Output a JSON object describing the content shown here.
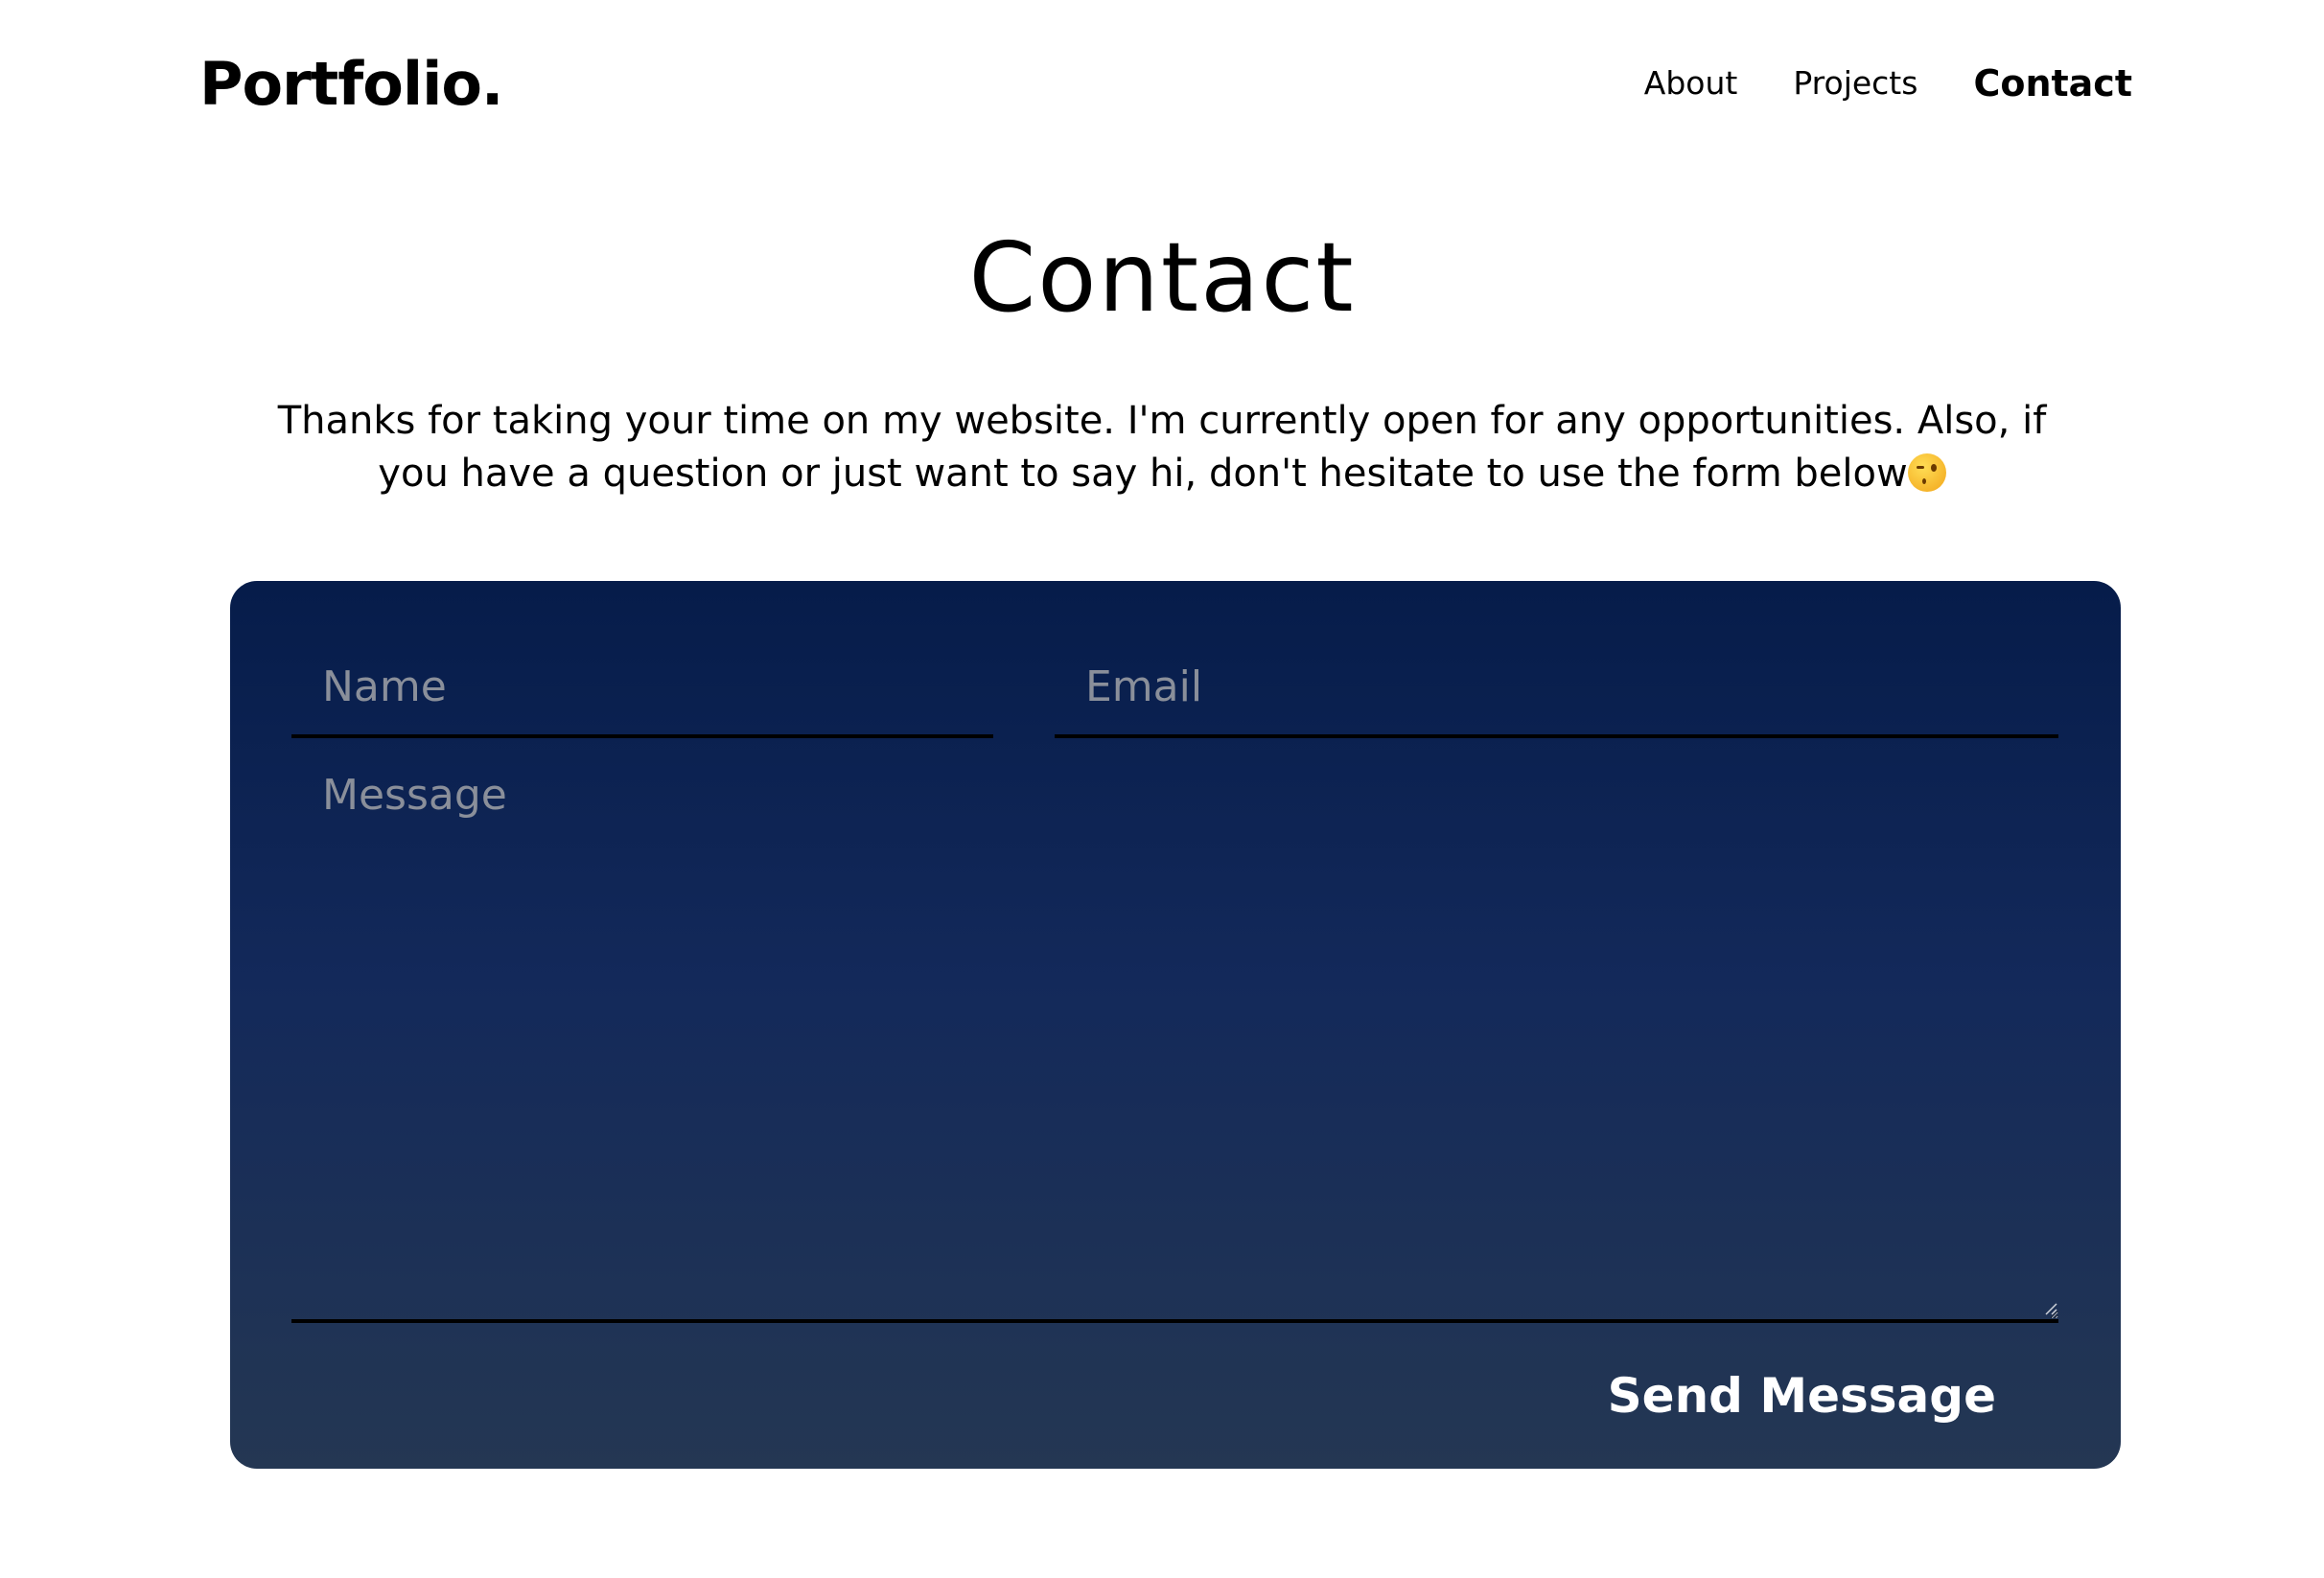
{
  "header": {
    "logo": "Portfolio.",
    "nav": [
      {
        "label": "About"
      },
      {
        "label": "Projects"
      },
      {
        "label": "Contact"
      }
    ],
    "active_item": "Contact"
  },
  "main": {
    "title": "Contact",
    "intro_text": "Thanks for taking your time on my website. I'm currently open for any opportunities. Also, if you have a question or just want to say hi, don't hesitate to use the form below",
    "intro_emoji_icon": "winking-face-emoji"
  },
  "form": {
    "name_placeholder": "Name",
    "email_placeholder": "Email",
    "message_placeholder": "Message",
    "name_value": "",
    "email_value": "",
    "message_value": "",
    "send_label": "Send Message"
  },
  "colors": {
    "form_top": "#061c4a",
    "form_bottom": "#243753",
    "placeholder": "#8a8f9a",
    "underline": "#000000"
  }
}
